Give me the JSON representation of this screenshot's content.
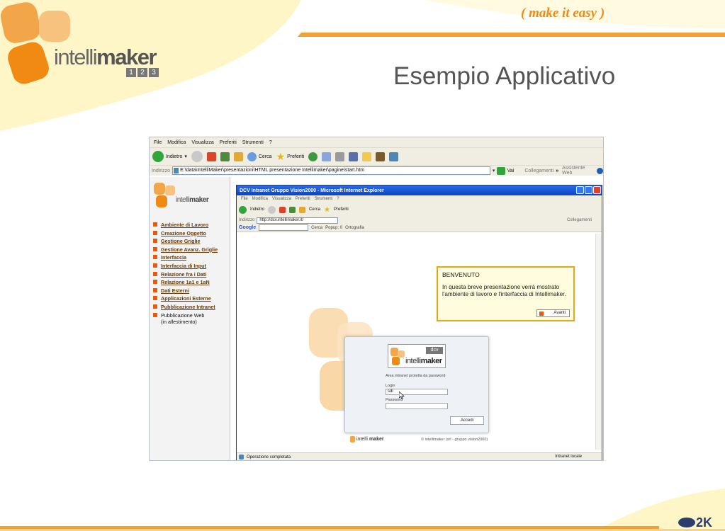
{
  "slide": {
    "tagline": "( make it easy )",
    "title": "Esempio Applicativo",
    "logo_light": "intelli",
    "logo_bold": "maker",
    "logo_numbers": [
      "1",
      "2",
      "3"
    ],
    "brand": "2K",
    "colors": {
      "accent": "#f5a033",
      "title": "#555555",
      "tagline": "#f08a12"
    }
  },
  "browser": {
    "menu": [
      "File",
      "Modifica",
      "Visualizza",
      "Preferiti",
      "Strumenti",
      "?"
    ],
    "toolbar": {
      "back": "Indietro",
      "search": "Cerca",
      "favorites": "Preferiti"
    },
    "address_label": "Indirizzo",
    "address_value": "E:\\data\\IntelliMaker\\presentazioni\\HTML presentazione Intellimaker\\pagine\\start.htm",
    "go_label": "Vai",
    "links_label": "Collegamenti",
    "links_more": "»",
    "assistant_label": "Assistente Web"
  },
  "sidebar": {
    "logo_light": "intelli",
    "logo_bold": "maker",
    "items": [
      "Ambiente di Lavoro",
      "Creazione Oggetto",
      "Gestione Griglie",
      "Gestione Avanz. Griglie",
      "Interfaccia",
      "Interfaccia di Input",
      "Relazione fra i Dati",
      "Relazione 1a1 e 1aN",
      "Dati Esterni",
      "Applicazioni Esterne",
      "Pubblicazione Intranet"
    ],
    "plain_item": "Pubblicazione Web",
    "plain_note": "(in allestimento)"
  },
  "inner": {
    "title": "DCV Intranet Gruppo Vision2000 - Microsoft Internet Explorer",
    "menu": [
      "File",
      "Modifica",
      "Visualizza",
      "Preferiti",
      "Strumenti",
      "?"
    ],
    "toolbar": {
      "back": "Indietro",
      "search": "Cerca",
      "favorites": "Preferiti"
    },
    "address_label": "Indirizzo",
    "address_value": "http://dcv.intellimaker.it/",
    "links_label": "Collegamenti",
    "google_label": "Google",
    "google_search": "Cerca",
    "google_popup": "Popup: 0",
    "google_spell": "Ortografia",
    "status": "Operazione completata",
    "status_zone": "Intranet locale"
  },
  "login": {
    "badge": "dcv",
    "logo_light": "intelli",
    "logo_bold": "maker",
    "caption": "Area intranet protetta da password",
    "user_label": "Login",
    "user_value": "sdi",
    "password_label": "Password",
    "submit": "Accedi",
    "footer_light": "intelli",
    "footer_bold": "maker",
    "copyright": "© intellimaker (srl - gruppo vision2000)"
  },
  "tooltip": {
    "title": "BENVENUTO",
    "body": "In questa breve presentazione verrà mostrato l'ambiente di lavoro e l'interfaccia di Intellimaker.",
    "button": "Avanti"
  }
}
